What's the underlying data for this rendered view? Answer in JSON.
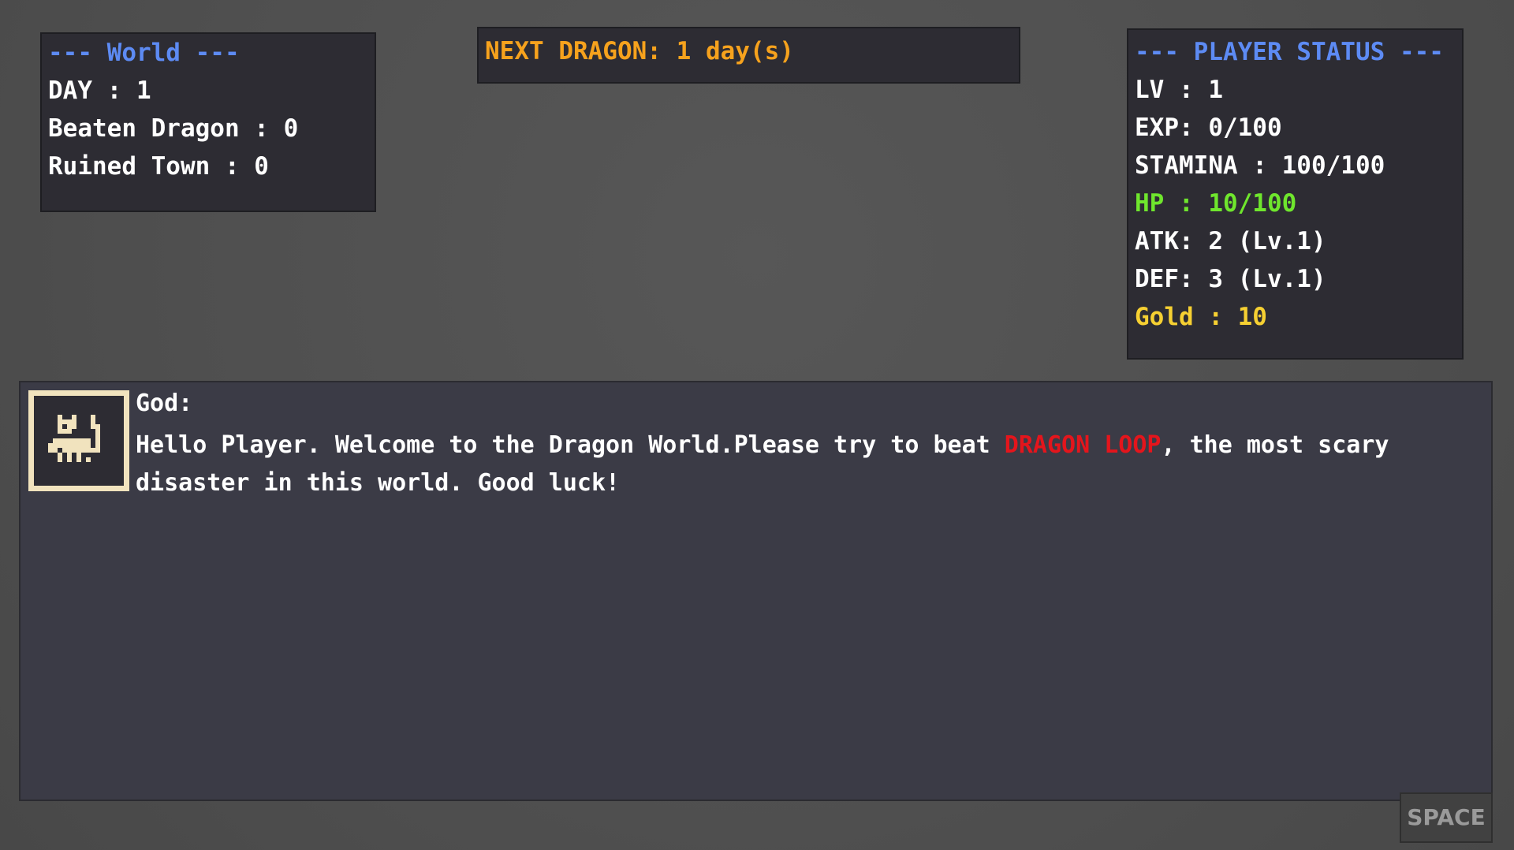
{
  "world": {
    "header": "--- World ---",
    "day": "DAY : 1",
    "beaten_dragon": "Beaten Dragon : 0",
    "ruined_town": "Ruined Town : 0"
  },
  "next_dragon": "NEXT DRAGON: 1 day(s)",
  "player_status": {
    "header": "--- PLAYER STATUS ---",
    "lv": "LV : 1",
    "exp": "EXP: 0/100",
    "stamina": "STAMINA : 100/100",
    "hp": "HP : 10/100",
    "atk": "ATK: 2 (Lv.1)",
    "def": "DEF: 3 (Lv.1)",
    "gold": "Gold : 10"
  },
  "dialog": {
    "speaker": "God:",
    "text_part1": "Hello Player. Welcome to the Dragon World.Please try to beat ",
    "highlight": "DRAGON LOOP",
    "text_part2": ", the most scary disaster in this world. Good luck!",
    "portrait_icon": "god-portrait-icon"
  },
  "space_button": "SPACE",
  "colors": {
    "header_blue": "#5d8bf4",
    "hp_green": "#6fe62d",
    "gold_yellow": "#f6d032",
    "dragon_orange": "#f6a21d",
    "highlight_red": "#e4151c"
  }
}
